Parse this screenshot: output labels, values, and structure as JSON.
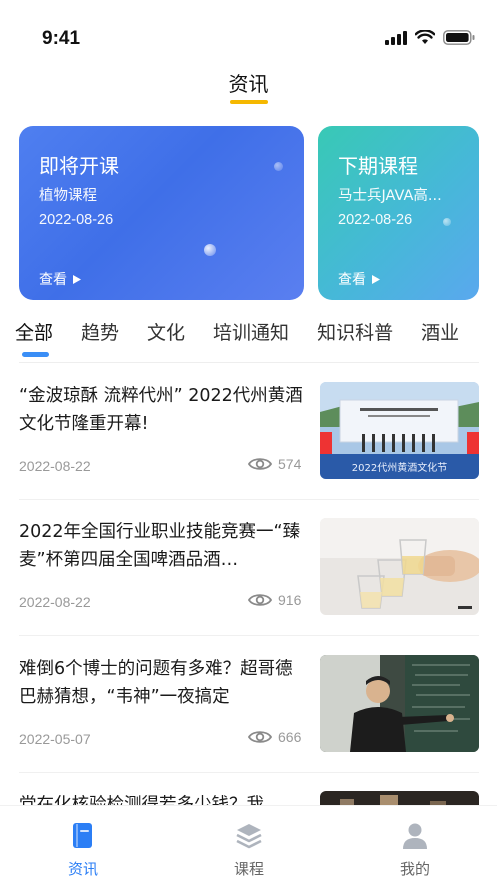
{
  "status_bar": {
    "time": "9:41"
  },
  "header": {
    "title": "资讯"
  },
  "cards": [
    {
      "title": "即将开课",
      "subtitle": "植物课程",
      "date": "2022-08-26",
      "view_label": "查看"
    },
    {
      "title": "下期课程",
      "subtitle": "马士兵JAVA高...",
      "date": "2022-08-26",
      "view_label": "查看"
    }
  ],
  "tabs": [
    "全部",
    "趋势",
    "文化",
    "培训通知",
    "知识科普",
    "酒业"
  ],
  "active_tab": "全部",
  "news": [
    {
      "title": "“金波琼酥 流粹代州” 2022代州黄酒文化节隆重开幕!",
      "date": "2022-08-22",
      "views": "574"
    },
    {
      "title": "2022年全国行业职业技能竞赛一“臻麦”杯第四届全国啤酒品酒…",
      "date": "2022-08-22",
      "views": "916"
    },
    {
      "title": "难倒6个博士的问题有多难？超哥德巴赫猜想，“韦神”一夜搞定",
      "date": "2022-05-07",
      "views": "666"
    },
    {
      "title": "党在化核验检测得若多少钱？我",
      "date": "",
      "views": ""
    }
  ],
  "thumb_text": {
    "banner": "2022代州黄酒文化节"
  },
  "bottom_nav": [
    {
      "label": "资讯",
      "icon": "book-icon",
      "active": true
    },
    {
      "label": "课程",
      "icon": "layers-icon",
      "active": false
    },
    {
      "label": "我的",
      "icon": "user-icon",
      "active": false
    }
  ],
  "colors": {
    "accent": "#2b7ef5",
    "title_underline": "#f5b800",
    "card1": "#4a78ee",
    "card2": "#3fc0c6"
  }
}
